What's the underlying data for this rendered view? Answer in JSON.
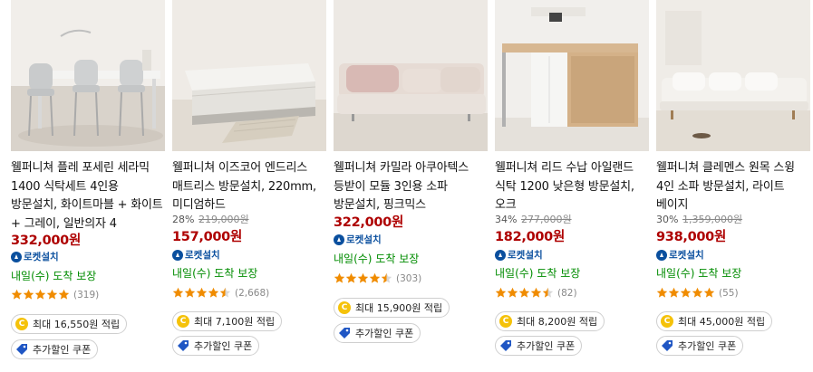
{
  "products": [
    {
      "title": "웰퍼니쳐 플레 포세린 세라믹 1400 식탁세트 4인용 방문설치, 화이트마블 + 화이트 + 그레이, 일반의자 4",
      "discount": "",
      "original_price": "",
      "price": "332,000원",
      "rocket_label": "로켓설치",
      "delivery": "내일(수) 도착 보장",
      "rating": 5.0,
      "review_count": "(319)",
      "reward": "최대 16,550원 적립",
      "coupon": "추가할인 쿠폰",
      "image": "dining-table-set"
    },
    {
      "title": "웰퍼니쳐 이즈코어 엔드리스 매트리스 방문설치, 220mm, 미디엄하드",
      "discount": "28%",
      "original_price": "219,000원",
      "price": "157,000원",
      "rocket_label": "로켓설치",
      "delivery": "내일(수) 도착 보장",
      "rating": 4.5,
      "review_count": "(2,668)",
      "reward": "최대 7,100원 적립",
      "coupon": "추가할인 쿠폰",
      "image": "mattress"
    },
    {
      "title": "웰퍼니쳐 카밀라 아쿠아텍스 등받이 모듈 3인용 소파 방문설치, 핑크믹스",
      "discount": "",
      "original_price": "",
      "price": "322,000원",
      "rocket_label": "로켓설치",
      "delivery": "내일(수) 도착 보장",
      "rating": 4.5,
      "review_count": "(303)",
      "reward": "최대 15,900원 적립",
      "coupon": "추가할인 쿠폰",
      "image": "pink-sofa"
    },
    {
      "title": "웰퍼니쳐 리드 수납 아일랜드 식탁 1200 낮은형 방문설치, 오크",
      "discount": "34%",
      "original_price": "277,000원",
      "price": "182,000원",
      "rocket_label": "로켓설치",
      "delivery": "내일(수) 도착 보장",
      "rating": 4.5,
      "review_count": "(82)",
      "reward": "최대 8,200원 적립",
      "coupon": "추가할인 쿠폰",
      "image": "island-table"
    },
    {
      "title": "웰퍼니쳐 클레멘스 원목 스윙 4인 소파 방문설치, 라이트 베이지",
      "discount": "30%",
      "original_price": "1,359,000원",
      "price": "938,000원",
      "rocket_label": "로켓설치",
      "delivery": "내일(수) 도착 보장",
      "rating": 5.0,
      "review_count": "(55)",
      "reward": "최대 45,000원 적립",
      "coupon": "추가할인 쿠폰",
      "image": "beige-sofa"
    }
  ],
  "colors": {
    "price": "#ae0000",
    "delivery": "#008c00",
    "rocket": "#0a4f9e",
    "star": "#f08c00",
    "coin": "#f5c20a"
  }
}
